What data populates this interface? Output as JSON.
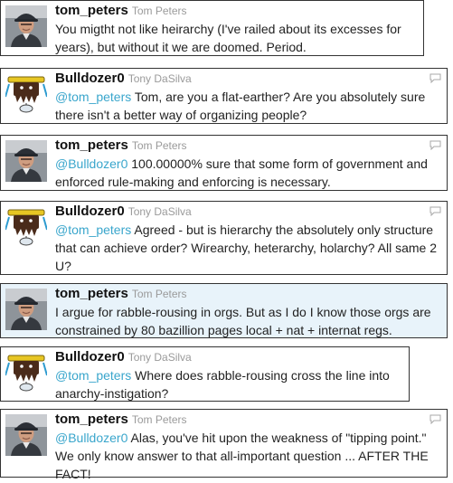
{
  "tweets": [
    {
      "handle": "tom_peters",
      "name": "Tom Peters",
      "avatar": "tom-peters-photo",
      "mention": "",
      "text": "You migtht not like heirarchy (I've railed about its excesses for years), but without it we are doomed. Period.",
      "highlighted": false,
      "reply_icon": false
    },
    {
      "handle": "Bulldozer0",
      "name": "Tony DaSilva",
      "avatar": "bulldozer-cartoon",
      "mention": "@tom_peters",
      "text": " Tom, are you a flat-earther? Are you absolutely sure there isn't a better way of organizing people?",
      "highlighted": false,
      "reply_icon": true
    },
    {
      "handle": "tom_peters",
      "name": "Tom Peters",
      "avatar": "tom-peters-photo",
      "mention": "@Bulldozer0",
      "text": " 100.00000% sure that some form of government and enforced rule-making and enforcing is necessary.",
      "highlighted": false,
      "reply_icon": true
    },
    {
      "handle": "Bulldozer0",
      "name": "Tony DaSilva",
      "avatar": "bulldozer-cartoon",
      "mention": "@tom_peters",
      "text": " Agreed - but is hierarchy the absolutely only structure that can achieve order? Wirearchy, heterarchy, holarchy? All same 2 U?",
      "highlighted": false,
      "reply_icon": true
    },
    {
      "handle": "tom_peters",
      "name": "Tom Peters",
      "avatar": "tom-peters-photo",
      "mention": "",
      "text": "I argue for rabble-rousing in orgs. But as I do I know those orgs are constrained by 80 bazillion pages local + nat + internat regs.",
      "highlighted": true,
      "reply_icon": false
    },
    {
      "handle": "Bulldozer0",
      "name": "Tony DaSilva",
      "avatar": "bulldozer-cartoon",
      "mention": "@tom_peters",
      "text": " Where does rabble-rousing cross the line into anarchy-instigation?",
      "highlighted": false,
      "reply_icon": false
    },
    {
      "handle": "tom_peters",
      "name": "Tom Peters",
      "avatar": "tom-peters-photo",
      "mention": "@Bulldozer0",
      "text": " Alas, you've hit upon the weakness of \"tipping point.\" We only know answer to that all-important question ... AFTER THE FACT!",
      "highlighted": false,
      "reply_icon": true
    }
  ],
  "colors": {
    "mention": "#3aa6cc",
    "highlight_bg": "#e8f3fa",
    "border": "#333333"
  }
}
